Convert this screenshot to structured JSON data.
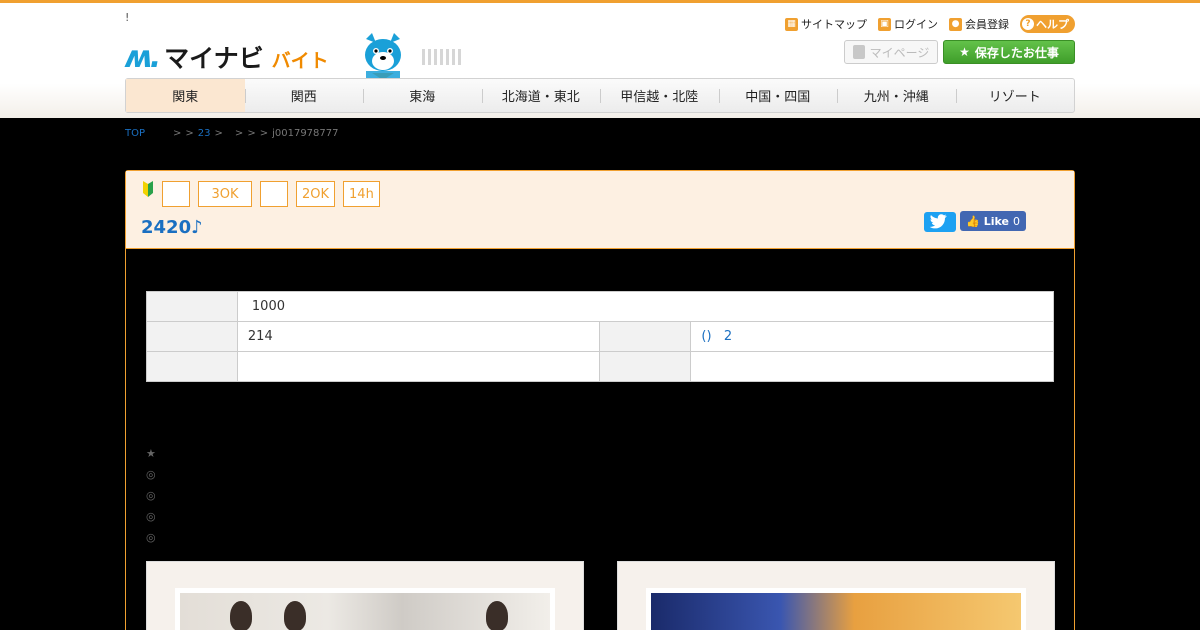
{
  "header": {
    "tagline": "!",
    "logo": {
      "mark": "ʍ.",
      "name": "マイナビ",
      "sub": "バイト"
    },
    "util_links": [
      {
        "icon": "sitemap-icon",
        "label": "サイトマップ"
      },
      {
        "icon": "lock-icon",
        "label": "ログイン"
      },
      {
        "icon": "user-register-icon",
        "label": "会員登録"
      }
    ],
    "help_label": "ヘルプ",
    "mypage_label": "マイページ",
    "saved_jobs_label": "保存したお仕事",
    "nav": [
      "関東",
      "関西",
      "東海",
      "北海道・東北",
      "甲信越・北陸",
      "中国・四国",
      "九州・沖縄",
      "リゾート"
    ]
  },
  "breadcrumb": {
    "top": "TOP",
    "sep1": ">",
    "sep2": ">",
    "area": "23",
    "sep3": ">",
    "sep4": ">",
    "sep5": ">",
    "sep6": ">",
    "job_id": "j0017978777"
  },
  "job": {
    "tags": [
      "",
      "3OK",
      "",
      "2OK",
      "14h"
    ],
    "title": "2420♪",
    "fb_like": "Like",
    "fb_count": "0"
  },
  "info_table": {
    "row1": {
      "label": "",
      "value": "1000"
    },
    "row2": {
      "label1": "",
      "value1": "214",
      "label2": "",
      "value2": "()   2"
    },
    "row3": {
      "label1": "",
      "value1": "",
      "label2": "",
      "value2": ""
    }
  },
  "points": [
    "★",
    "◎",
    "◎",
    "◎",
    "◎"
  ],
  "colors": {
    "accent": "#f0a030",
    "link": "#1a6fc1",
    "green": "#4caf34"
  }
}
